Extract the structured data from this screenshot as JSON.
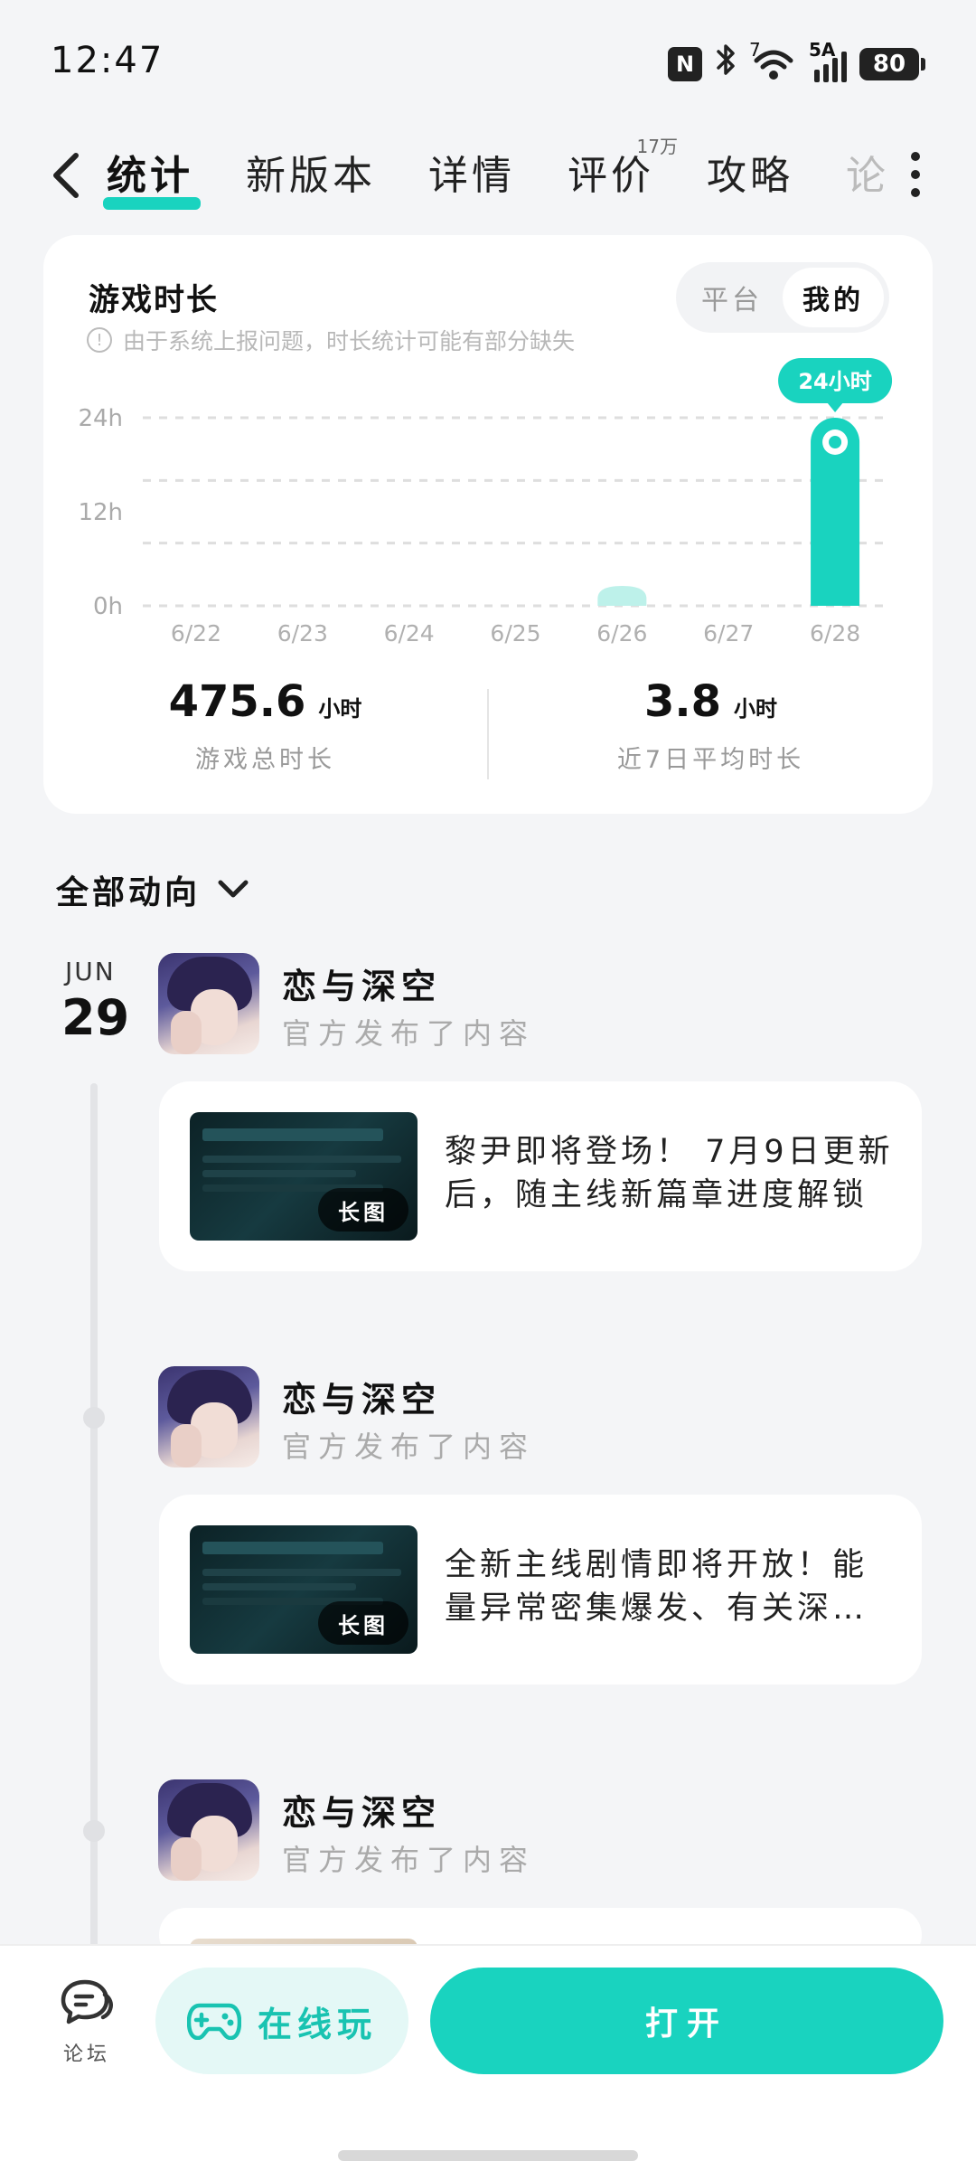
{
  "status_bar": {
    "time": "12:47",
    "nfc_label": "N",
    "wifi_sup": "7",
    "signal_sup": "5A",
    "battery": "80"
  },
  "tabs": [
    {
      "label": "统计",
      "active": true
    },
    {
      "label": "新版本"
    },
    {
      "label": "详情"
    },
    {
      "label": "评价",
      "badge": "17万"
    },
    {
      "label": "攻略"
    },
    {
      "label": "论",
      "faded": true
    }
  ],
  "stats_card": {
    "title": "游戏时长",
    "note": "由于系统上报问题，时长统计可能有部分缺失",
    "toggle": {
      "options": [
        "平台",
        "我的"
      ],
      "selected": "我的"
    },
    "summary": [
      {
        "value": "475.6",
        "unit": "小时",
        "label": "游戏总时长"
      },
      {
        "value": "3.8",
        "unit": "小时",
        "label": "近7日平均时长"
      }
    ]
  },
  "chart_data": {
    "type": "bar",
    "title": "",
    "xlabel": "",
    "ylabel": "",
    "ylim": [
      0,
      24
    ],
    "y_ticks": [
      "24h",
      "12h",
      "0h"
    ],
    "y_tick_values": [
      24,
      12,
      0
    ],
    "categories": [
      "6/22",
      "6/23",
      "6/24",
      "6/25",
      "6/26",
      "6/27",
      "6/28"
    ],
    "values": [
      0,
      0,
      0,
      0,
      0.5,
      0,
      24
    ],
    "highlight_label": "24小时",
    "bar_color": "#19d3bf",
    "bar_color_faded": "#bdf1ea",
    "grid": true
  },
  "activity": {
    "title": "全部动向",
    "date_month": "JUN",
    "date_day": "29",
    "posts": [
      {
        "name": "恋与深空",
        "sub": "官方发布了内容",
        "text": "黎尹即将登场！ 7月9日更新后，随主线新篇章进度解锁",
        "thumb_badge": "长图"
      },
      {
        "name": "恋与深空",
        "sub": "官方发布了内容",
        "text": "全新主线剧情即将开放！能量异常密集爆发、有关深空的秘密",
        "thumb_badge": "长图"
      },
      {
        "name": "恋与深空",
        "sub": "官方发布了内容"
      }
    ]
  },
  "bottom_bar": {
    "forum_label": "论坛",
    "play_online_label": "在线玩",
    "open_label": "打开"
  },
  "colors": {
    "accent": "#19d3bf",
    "accent_light": "#e4f8f6",
    "background": "#f4f5f7"
  },
  "icons": [
    "back-icon",
    "more-icon",
    "info-icon",
    "chevron-down-icon",
    "chat-icon",
    "gamepad-icon"
  ]
}
